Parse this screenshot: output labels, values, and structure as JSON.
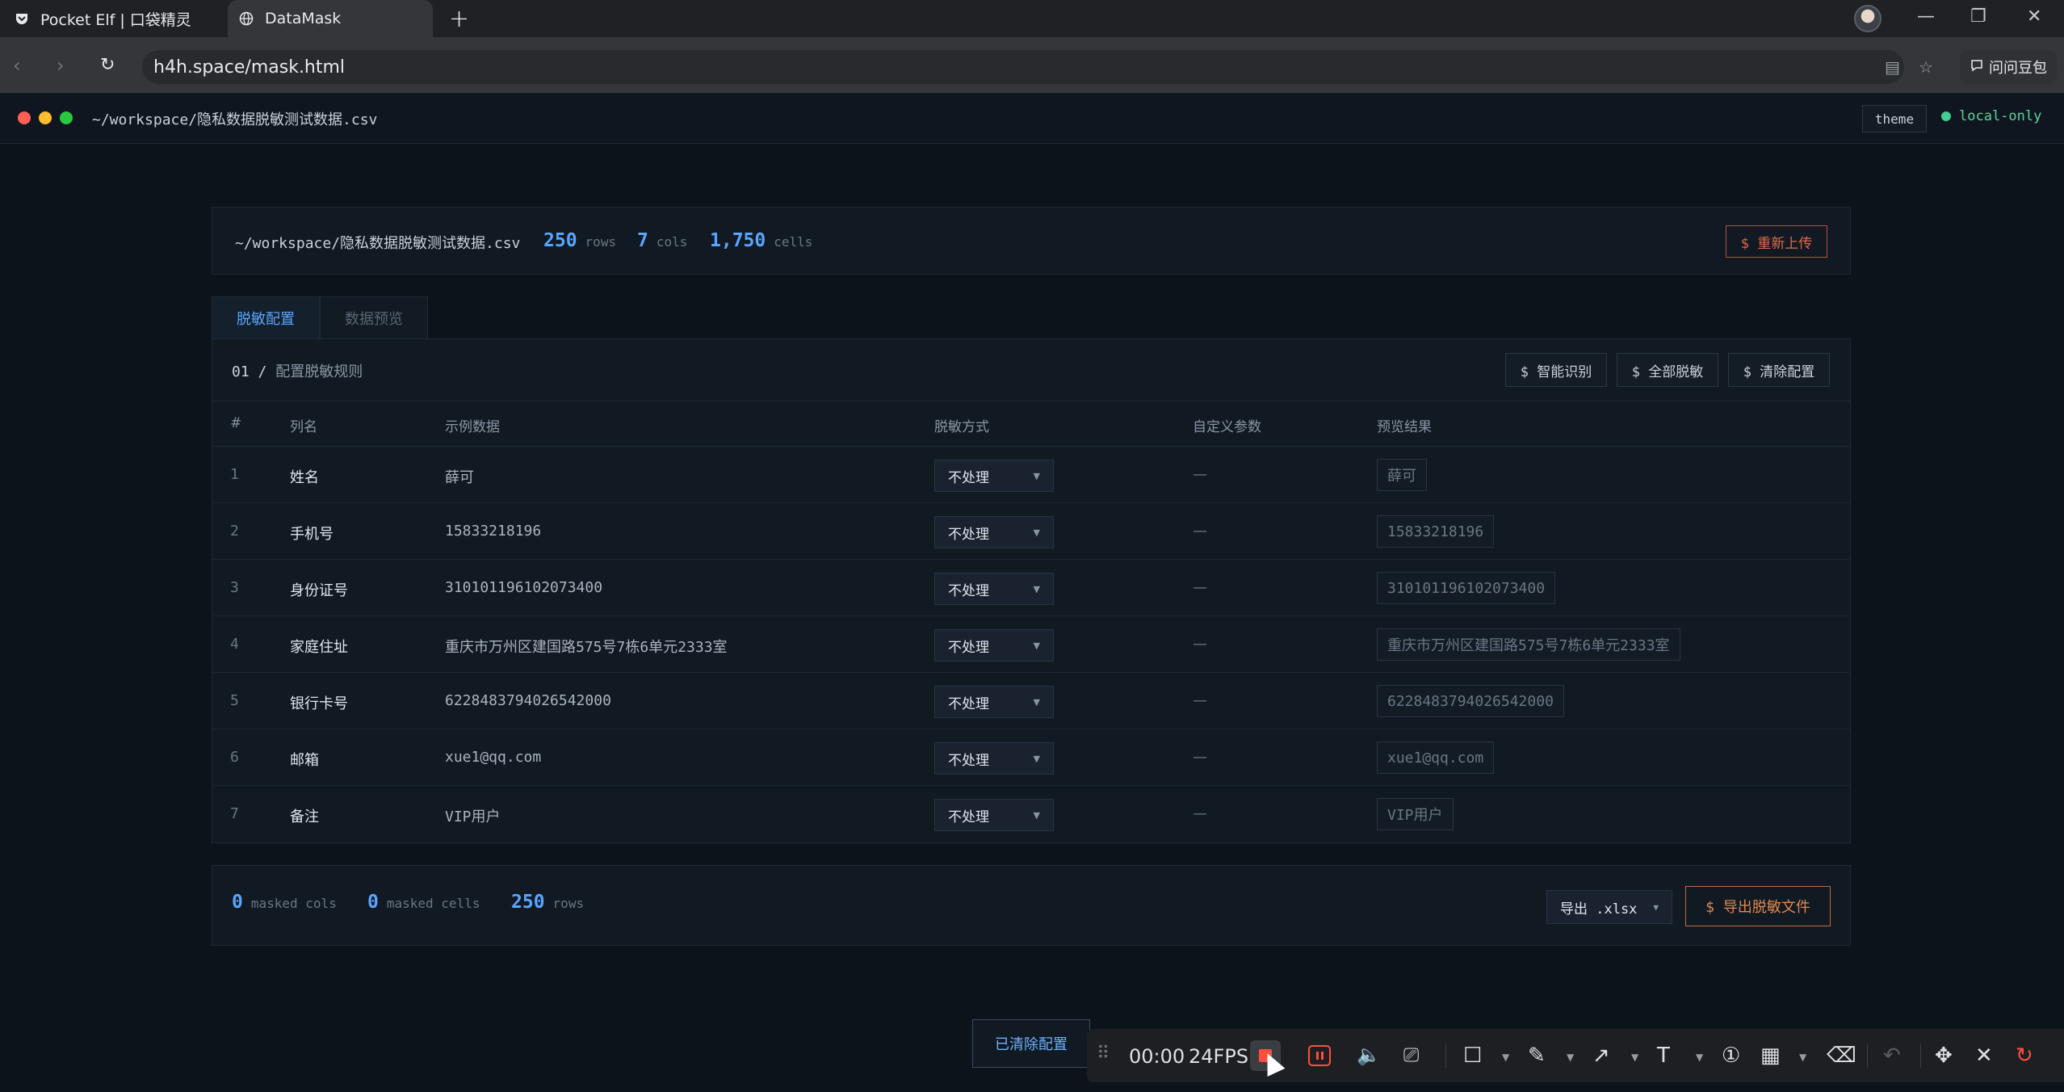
{
  "browser": {
    "tabs": [
      {
        "title": "Pocket Elf | 口袋精灵",
        "icon": "pocket-icon"
      },
      {
        "title": "DataMask",
        "icon": "globe-icon"
      }
    ],
    "url": "h4h.space/mask.html",
    "ask_button": "问问豆包"
  },
  "app": {
    "path": "~/workspace/隐私数据脱敏测试数据.csv",
    "theme_label": "theme",
    "status_label": "local-only",
    "status_color": "#3fcf8e",
    "accent_color": "#58a6ff"
  },
  "file": {
    "path": "~/workspace/隐私数据脱敏测试数据.csv",
    "rows_num": "250",
    "rows_label": "rows",
    "cols_num": "7",
    "cols_label": "cols",
    "cells_num": "1,750",
    "cells_label": "cells",
    "reupload": "$ 重新上传"
  },
  "tabs": {
    "config": "脱敏配置",
    "preview": "数据预览"
  },
  "rules": {
    "step": "01 /",
    "title": "配置脱敏规则",
    "smart": "$ 智能识别",
    "mask_all": "$ 全部脱敏",
    "clear": "$ 清除配置",
    "headers": {
      "idx": "#",
      "name": "列名",
      "sample": "示例数据",
      "method": "脱敏方式",
      "params": "自定义参数",
      "preview": "预览结果"
    },
    "rows": [
      {
        "idx": "1",
        "name": "姓名",
        "sample": "薛可",
        "method": "不处理",
        "param": "—",
        "preview": "薛可"
      },
      {
        "idx": "2",
        "name": "手机号",
        "sample": "15833218196",
        "method": "不处理",
        "param": "—",
        "preview": "15833218196"
      },
      {
        "idx": "3",
        "name": "身份证号",
        "sample": "310101196102073400",
        "method": "不处理",
        "param": "—",
        "preview": "310101196102073400"
      },
      {
        "idx": "4",
        "name": "家庭住址",
        "sample": "重庆市万州区建国路575号7栋6单元2333室",
        "method": "不处理",
        "param": "—",
        "preview": "重庆市万州区建国路575号7栋6单元2333室"
      },
      {
        "idx": "5",
        "name": "银行卡号",
        "sample": "6228483794026542000",
        "method": "不处理",
        "param": "—",
        "preview": "6228483794026542000"
      },
      {
        "idx": "6",
        "name": "邮箱",
        "sample": "xue1@qq.com",
        "method": "不处理",
        "param": "—",
        "preview": "xue1@qq.com"
      },
      {
        "idx": "7",
        "name": "备注",
        "sample": "VIP用户",
        "method": "不处理",
        "param": "—",
        "preview": "VIP用户"
      }
    ]
  },
  "footer": {
    "masked_cols_num": "0",
    "masked_cols_label": "masked cols",
    "masked_cells_num": "0",
    "masked_cells_label": "masked cells",
    "rows_num": "250",
    "rows_label": "rows",
    "format": "导出 .xlsx",
    "export": "$ 导出脱敏文件"
  },
  "toast": "已清除配置",
  "recorder": {
    "time": "00:00",
    "fps": "24FPS"
  }
}
